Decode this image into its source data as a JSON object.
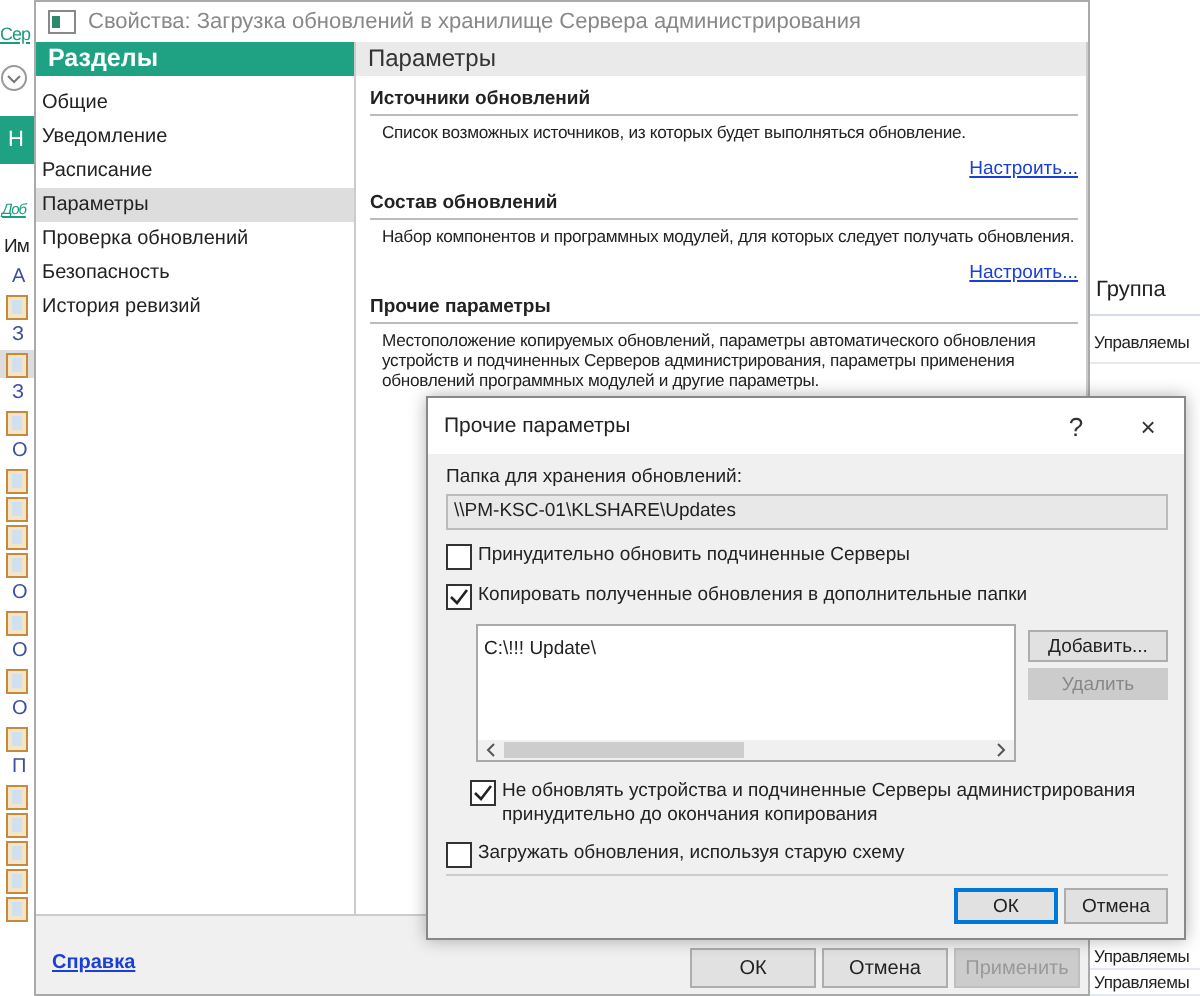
{
  "background_app": {
    "link": "Сер",
    "tab": "Н",
    "add_link": "Доб",
    "column_1": "Им",
    "column_2": "Группа",
    "left_rows": [
      {
        "kind": "label",
        "text": "А"
      },
      {
        "kind": "icon",
        "selected": false
      },
      {
        "kind": "label",
        "text": "З"
      },
      {
        "kind": "icon",
        "selected": true
      },
      {
        "kind": "label",
        "text": "З"
      },
      {
        "kind": "icon",
        "selected": false
      },
      {
        "kind": "label",
        "text": "О"
      },
      {
        "kind": "icon",
        "selected": false
      },
      {
        "kind": "icon",
        "selected": false
      },
      {
        "kind": "icon",
        "selected": false
      },
      {
        "kind": "icon",
        "selected": false
      },
      {
        "kind": "label",
        "text": "О"
      },
      {
        "kind": "icon",
        "selected": false
      },
      {
        "kind": "label",
        "text": "О"
      },
      {
        "kind": "icon",
        "selected": false
      },
      {
        "kind": "label",
        "text": "О"
      },
      {
        "kind": "icon",
        "selected": false
      },
      {
        "kind": "label",
        "text": "П"
      },
      {
        "kind": "icon",
        "selected": false
      },
      {
        "kind": "icon",
        "selected": false
      },
      {
        "kind": "icon",
        "selected": false
      },
      {
        "kind": "icon",
        "selected": false
      },
      {
        "kind": "icon",
        "selected": false
      }
    ],
    "right_rows_top": [
      "Управляемы"
    ],
    "right_rows_bottom": [
      "Управляемы",
      "Управляемы"
    ]
  },
  "window": {
    "title": "Свойства: Загрузка обновлений в хранилище Сервера администрирования",
    "sidebar": {
      "title": "Разделы",
      "items": [
        {
          "label": "Общие",
          "selected": false
        },
        {
          "label": "Уведомление",
          "selected": false
        },
        {
          "label": "Расписание",
          "selected": false
        },
        {
          "label": "Параметры",
          "selected": true
        },
        {
          "label": "Проверка обновлений",
          "selected": false
        },
        {
          "label": "Безопасность",
          "selected": false
        },
        {
          "label": "История ревизий",
          "selected": false
        }
      ]
    },
    "panel": {
      "title": "Параметры",
      "sections": [
        {
          "title": "Источники обновлений",
          "text": "Список возможных источников, из которых будет выполняться обновление.",
          "link": "Настроить..."
        },
        {
          "title": "Состав обновлений",
          "text": "Набор компонентов и программных модулей, для которых следует получать обновления.",
          "link": "Настроить..."
        },
        {
          "title": "Прочие параметры",
          "text": "Местоположение копируемых обновлений, параметры автоматического обновления устройств и подчиненных Серверов администрирования, параметры применения обновлений программных модулей и другие параметры."
        }
      ]
    },
    "help_link": "Справка",
    "buttons": [
      {
        "label": "ОК",
        "disabled": false
      },
      {
        "label": "Отмена",
        "disabled": false
      },
      {
        "label": "Применить",
        "disabled": true
      }
    ]
  },
  "dialog": {
    "title": "Прочие параметры",
    "help": "?",
    "close": "×",
    "folder_label": "Папка для хранения обновлений:",
    "folder_value": "\\\\PM-KSC-01\\KLSHARE\\Updates",
    "options": [
      {
        "kind": "checkbox",
        "label": "Принудительно обновить подчиненные Серверы",
        "checked": false,
        "indented": false
      },
      {
        "kind": "checkbox",
        "label": "Копировать полученные обновления в дополнительные папки",
        "checked": true,
        "indented": false
      },
      {
        "kind": "folders",
        "items": [
          "C:\\!!! Update\\"
        ],
        "buttons": [
          {
            "label": "Добавить...",
            "disabled": false
          },
          {
            "label": "Удалить",
            "disabled": true
          }
        ]
      },
      {
        "kind": "checkbox",
        "label": "Не обновлять устройства и подчиненные Серверы администрирования принудительно до окончания копирования",
        "checked": true,
        "indented": true
      },
      {
        "kind": "checkbox",
        "label": "Загружать обновления, используя старую схему",
        "checked": false,
        "indented": false
      }
    ],
    "buttons": [
      {
        "label": "ОК",
        "default": true
      },
      {
        "label": "Отмена",
        "default": false
      }
    ]
  }
}
